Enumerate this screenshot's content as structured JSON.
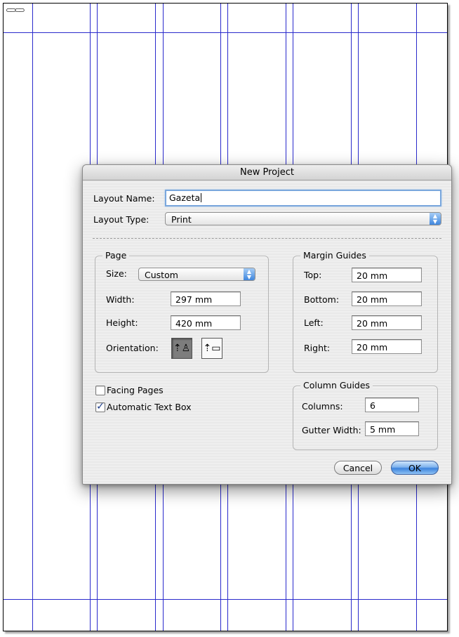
{
  "page_guides": {
    "icon": "link-chain-icon",
    "guide_color": "#2a2acc"
  },
  "dialog": {
    "title": "New Project",
    "layout_name_label": "Layout Name:",
    "layout_name_value": "Gazeta",
    "layout_type_label": "Layout Type:",
    "layout_type_value": "Print",
    "page": {
      "title": "Page",
      "size_label": "Size:",
      "size_value": "Custom",
      "width_label": "Width:",
      "width_value": "297 mm",
      "height_label": "Height:",
      "height_value": "420 mm",
      "orientation_label": "Orientation:",
      "orientation_selected": "portrait"
    },
    "margin_guides": {
      "title": "Margin Guides",
      "top_label": "Top:",
      "top_value": "20 mm",
      "bottom_label": "Bottom:",
      "bottom_value": "20 mm",
      "left_label": "Left:",
      "left_value": "20 mm",
      "right_label": "Right:",
      "right_value": "20 mm"
    },
    "facing_pages_label": "Facing Pages",
    "facing_pages_checked": false,
    "auto_text_box_label": "Automatic Text Box",
    "auto_text_box_checked": true,
    "column_guides": {
      "title": "Column Guides",
      "columns_label": "Columns:",
      "columns_value": "6",
      "gutter_label": "Gutter Width:",
      "gutter_value": "5 mm"
    },
    "cancel_label": "Cancel",
    "ok_label": "OK",
    "accent_color": "#3d84dd"
  }
}
